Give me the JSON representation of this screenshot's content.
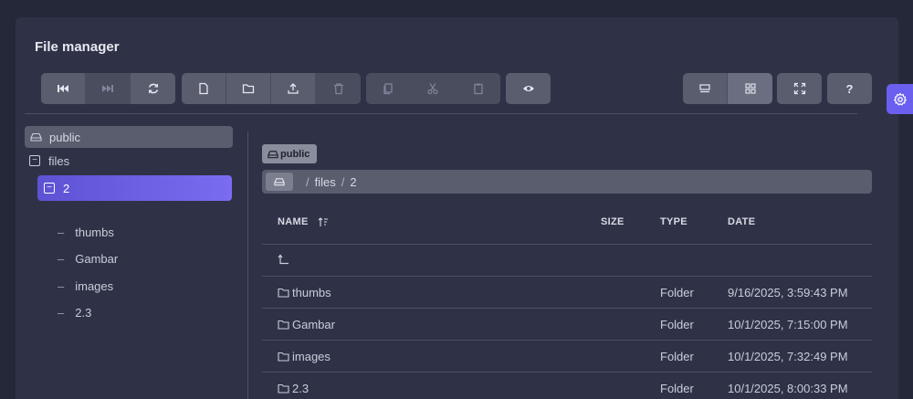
{
  "title": "File manager",
  "toolbar": {
    "history": [
      "back-icon",
      "forward-icon",
      "refresh-icon"
    ],
    "file_ops": [
      "new-file-icon",
      "new-folder-icon",
      "upload-icon",
      "delete-icon"
    ],
    "clip_ops": [
      "copy-icon",
      "cut-icon",
      "paste-icon"
    ],
    "preview": "eye-icon",
    "view_modes": [
      "list-view-icon",
      "grid-view-icon"
    ],
    "fullscreen": "fullscreen-icon",
    "help_label": "?"
  },
  "tree": {
    "root": "public",
    "folder": "files",
    "selected": "2",
    "children": [
      "thumbs",
      "Gambar",
      "images",
      "2.3"
    ]
  },
  "storage_tab": "public",
  "breadcrumb": {
    "parts": [
      "files",
      "2"
    ],
    "separator": "/"
  },
  "table": {
    "headers": {
      "name": "NAME",
      "size": "SIZE",
      "type": "TYPE",
      "date": "DATE"
    },
    "rows": [
      {
        "name": "thumbs",
        "size": "",
        "type": "Folder",
        "date": "9/16/2025, 3:59:43 PM"
      },
      {
        "name": "Gambar",
        "size": "",
        "type": "Folder",
        "date": "10/1/2025, 7:15:00 PM"
      },
      {
        "name": "images",
        "size": "",
        "type": "Folder",
        "date": "10/1/2025, 7:32:49 PM"
      },
      {
        "name": "2.3",
        "size": "",
        "type": "Folder",
        "date": "10/1/2025, 8:00:33 PM"
      }
    ]
  },
  "colors": {
    "accent": "#6b5ff0",
    "panel": "#2f3247",
    "button": "#595d6e"
  }
}
